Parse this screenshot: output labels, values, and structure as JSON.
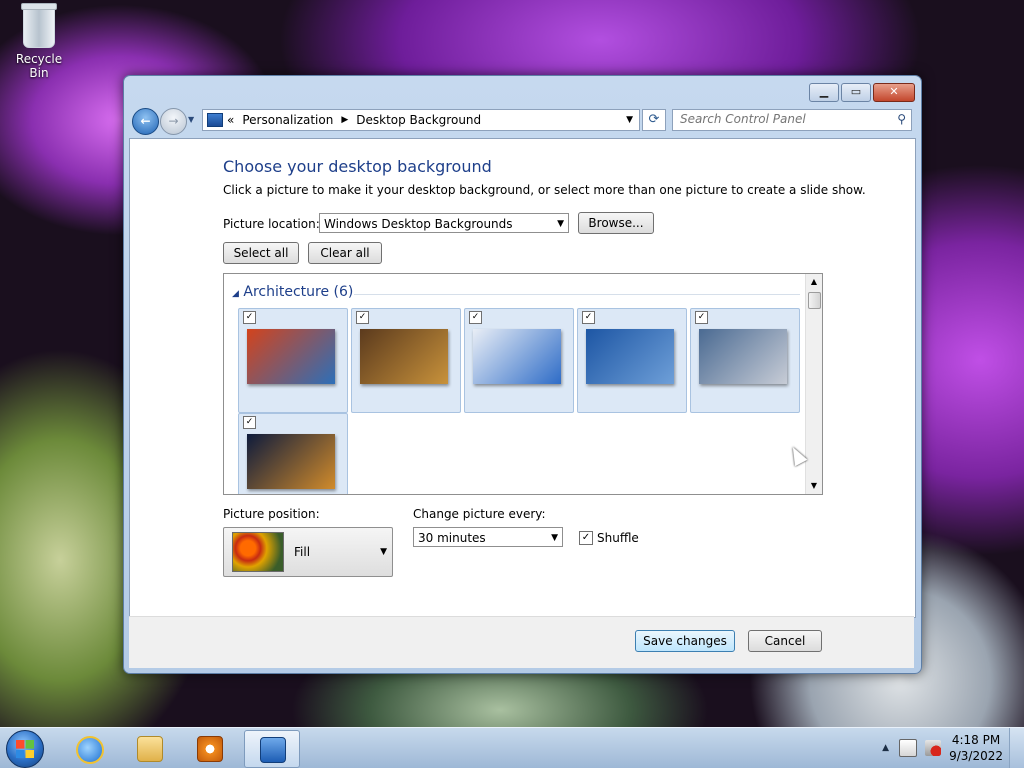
{
  "desktop": {
    "icons": [
      {
        "label": "Recycle Bin"
      }
    ]
  },
  "window": {
    "address": {
      "overflow_chevron": "«",
      "crumbs": [
        "Personalization",
        "Desktop Background"
      ],
      "separator": "▶",
      "dropdown": "▼",
      "refresh": "⟳"
    },
    "search": {
      "placeholder": "Search Control Panel"
    },
    "caption": {
      "minimize": "▁",
      "maximize": "▭",
      "close": "✕"
    },
    "title": "Choose your desktop background",
    "subtitle": "Click a picture to make it your desktop background, or select more than one picture to create a slide show.",
    "picture_location": {
      "label": "Picture location:",
      "value": "Windows Desktop Backgrounds"
    },
    "browse_label": "Browse...",
    "select_all_label": "Select all",
    "clear_all_label": "Clear all",
    "gallery": {
      "group": "Architecture (6)",
      "collapse_glyph": "◢",
      "check_glyph": "✓",
      "thumbnails": [
        {
          "checked": true,
          "colors": [
            "#d3431c",
            "#2d6fb8"
          ]
        },
        {
          "checked": true,
          "colors": [
            "#5b3a1d",
            "#c8923b"
          ]
        },
        {
          "checked": true,
          "colors": [
            "#e9eef6",
            "#2e6cc7"
          ]
        },
        {
          "checked": true,
          "colors": [
            "#1d56a4",
            "#6e9fd8"
          ]
        },
        {
          "checked": true,
          "colors": [
            "#4a6a92",
            "#c7ccd6"
          ]
        },
        {
          "checked": true,
          "colors": [
            "#0e1b3c",
            "#d18b2b"
          ]
        }
      ]
    },
    "picture_position": {
      "label": "Picture position:",
      "value": "Fill"
    },
    "change_picture": {
      "label": "Change picture every:",
      "value": "30 minutes"
    },
    "shuffle": {
      "label": "Shuffle",
      "checked": true
    },
    "save_label": "Save changes",
    "cancel_label": "Cancel"
  },
  "taskbar": {
    "clock": {
      "time": "4:18 PM",
      "date": "9/3/2022"
    },
    "tray_arrow": "▲"
  },
  "colors": {
    "accent": "#1e3f8a",
    "taskbar": "#b3c9e2"
  }
}
